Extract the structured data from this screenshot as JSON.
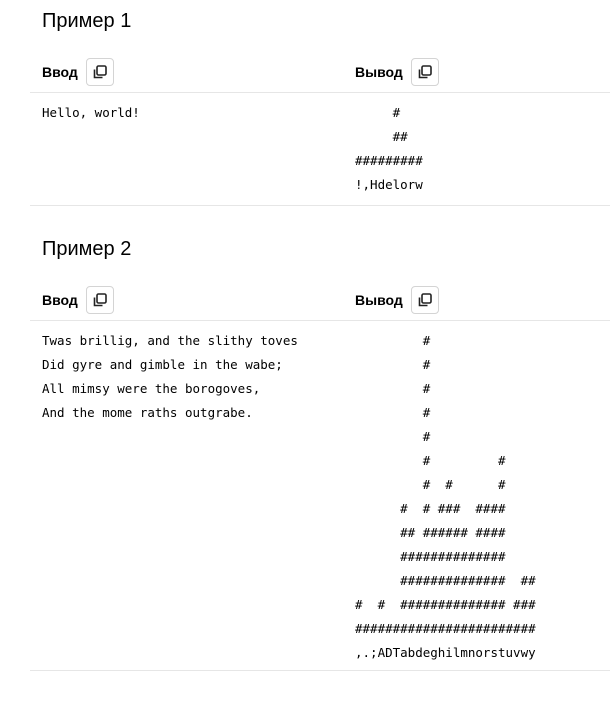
{
  "examples": [
    {
      "title": "Пример 1",
      "input_label": "Ввод",
      "output_label": "Вывод",
      "input": "Hello, world!",
      "output": "     #\n     ##\n#########\n!,Hdelorw"
    },
    {
      "title": "Пример 2",
      "input_label": "Ввод",
      "output_label": "Вывод",
      "input": "Twas brillig, and the slithy toves\nDid gyre and gimble in the wabe;\nAll mimsy were the borogoves,\nAnd the mome raths outgrabe.",
      "output": "         #\n         #\n         #\n         #\n         #\n         #         #\n         #  #      #\n      #  # ###  ####\n      ## ###### ####\n      ##############\n      ##############  ##\n#  #  ############## ###\n########################\n,.;ADTabdeghilmnorstuvwy"
    }
  ],
  "icons": {
    "copy": "copy-icon"
  }
}
